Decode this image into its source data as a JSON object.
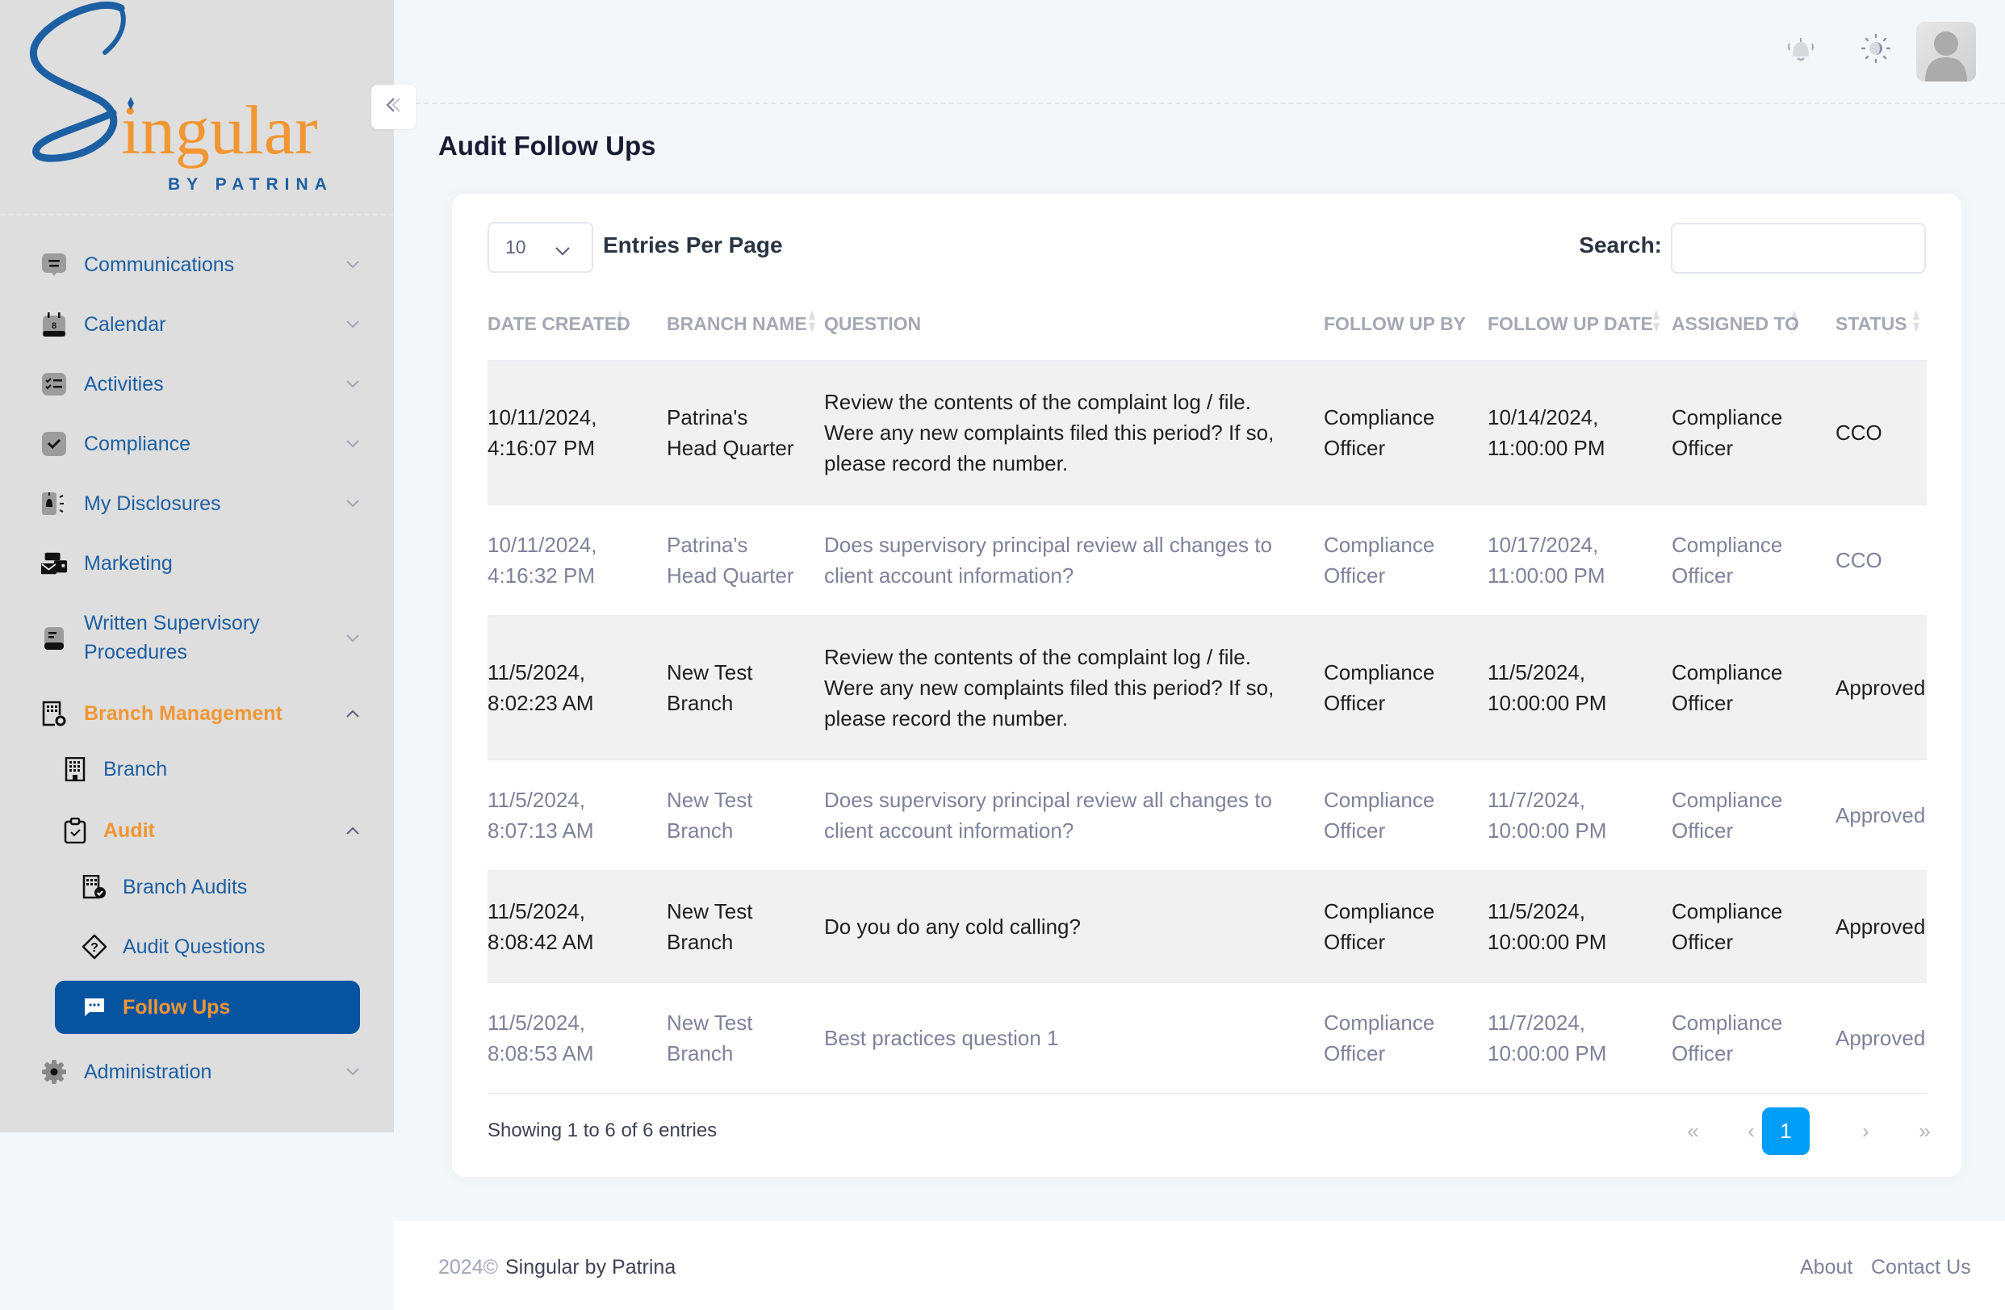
{
  "brand": {
    "logo_script_letter": "S",
    "logo_word": "ingular",
    "logo_tagline": "BY PATRINA",
    "colors": {
      "blue": "#1d5fa3",
      "orange": "#f29633",
      "active_bg": "#0653a0",
      "page_active": "#009ef7"
    }
  },
  "sidebar": {
    "collapse_icon": "double-chevron-left-icon",
    "items": [
      {
        "label": "Communications",
        "icon": "chat-lines-icon",
        "chevron": "down"
      },
      {
        "label": "Calendar",
        "icon": "calendar-icon",
        "chevron": "down"
      },
      {
        "label": "Activities",
        "icon": "checklist-icon",
        "chevron": "down"
      },
      {
        "label": "Compliance",
        "icon": "check-square-icon",
        "chevron": "down"
      },
      {
        "label": "My Disclosures",
        "icon": "disclosure-bell-icon",
        "chevron": "down"
      },
      {
        "label": "Marketing",
        "icon": "marketing-envelope-icon",
        "chevron": ""
      },
      {
        "label_line1": "Written Supervisory",
        "label_line2": "Procedures",
        "icon": "document-icon",
        "chevron": "down"
      },
      {
        "label": "Branch Management",
        "icon": "building-gear-icon",
        "chevron": "up",
        "expanded": true
      },
      {
        "label": "Branch",
        "icon": "building-icon"
      },
      {
        "label": "Audit",
        "icon": "clipboard-check-icon",
        "chevron": "up",
        "expanded": true
      },
      {
        "label": "Branch Audits",
        "icon": "building-check-icon"
      },
      {
        "label": "Audit Questions",
        "icon": "question-diamond-icon"
      },
      {
        "label": "Follow Ups",
        "icon": "chat-dots-icon",
        "active": true
      },
      {
        "label": "Administration",
        "icon": "gear-icon",
        "chevron": "down"
      }
    ]
  },
  "header": {
    "icons": [
      "bell-icon",
      "theme-toggle-icon",
      "avatar"
    ]
  },
  "page": {
    "title": "Audit Follow Ups"
  },
  "table_controls": {
    "entries_value": "10",
    "entries_label": "Entries Per Page",
    "search_label": "Search:",
    "search_value": "",
    "search_placeholder": ""
  },
  "table": {
    "columns": [
      "DATE CREATED",
      "BRANCH NAME",
      "QUESTION",
      "FOLLOW UP BY",
      "FOLLOW UP DATE",
      "ASSIGNED TO",
      "STATUS"
    ],
    "rows": [
      {
        "date_created": [
          "10/11/2024,",
          "4:16:07 PM"
        ],
        "branch_name": [
          "Patrina's",
          "Head Quarter"
        ],
        "question": [
          "Review the contents of the complaint log / file.",
          "Were any new complaints filed this period? If so,",
          "please record the number."
        ],
        "follow_up_by": [
          "Compliance",
          "Officer"
        ],
        "follow_up_date": [
          "10/14/2024,",
          "11:00:00 PM"
        ],
        "assigned_to": [
          "Compliance",
          "Officer"
        ],
        "status": "CCO"
      },
      {
        "date_created": [
          "10/11/2024,",
          "4:16:32 PM"
        ],
        "branch_name": [
          "Patrina's",
          "Head Quarter"
        ],
        "question": [
          "Does supervisory principal review all changes to",
          "client account information?"
        ],
        "follow_up_by": [
          "Compliance",
          "Officer"
        ],
        "follow_up_date": [
          "10/17/2024,",
          "11:00:00 PM"
        ],
        "assigned_to": [
          "Compliance",
          "Officer"
        ],
        "status": "CCO"
      },
      {
        "date_created": [
          "11/5/2024,",
          "8:02:23 AM"
        ],
        "branch_name": [
          "New Test",
          "Branch"
        ],
        "question": [
          "Review the contents of the complaint log / file.",
          "Were any new complaints filed this period? If so,",
          "please record the number."
        ],
        "follow_up_by": [
          "Compliance",
          "Officer"
        ],
        "follow_up_date": [
          "11/5/2024,",
          "10:00:00 PM"
        ],
        "assigned_to": [
          "Compliance",
          "Officer"
        ],
        "status": "Approved"
      },
      {
        "date_created": [
          "11/5/2024,",
          "8:07:13 AM"
        ],
        "branch_name": [
          "New Test",
          "Branch"
        ],
        "question": [
          "Does supervisory principal review all changes to",
          "client account information?"
        ],
        "follow_up_by": [
          "Compliance",
          "Officer"
        ],
        "follow_up_date": [
          "11/7/2024,",
          "10:00:00 PM"
        ],
        "assigned_to": [
          "Compliance",
          "Officer"
        ],
        "status": "Approved"
      },
      {
        "date_created": [
          "11/5/2024,",
          "8:08:42 AM"
        ],
        "branch_name": [
          "New Test",
          "Branch"
        ],
        "question": [
          "Do you do any cold calling?"
        ],
        "follow_up_by": [
          "Compliance",
          "Officer"
        ],
        "follow_up_date": [
          "11/5/2024,",
          "10:00:00 PM"
        ],
        "assigned_to": [
          "Compliance",
          "Officer"
        ],
        "status": "Approved"
      },
      {
        "date_created": [
          "11/5/2024,",
          "8:08:53 AM"
        ],
        "branch_name": [
          "New Test",
          "Branch"
        ],
        "question": [
          "Best practices question 1"
        ],
        "follow_up_by": [
          "Compliance",
          "Officer"
        ],
        "follow_up_date": [
          "11/7/2024,",
          "10:00:00 PM"
        ],
        "assigned_to": [
          "Compliance",
          "Officer"
        ],
        "status": "Approved"
      }
    ]
  },
  "pagination": {
    "summary": "Showing 1 to 6 of 6 entries",
    "first": "«",
    "prev": "‹",
    "current": "1",
    "next": "›",
    "last": "»"
  },
  "footer": {
    "year": "2024©",
    "brand": "Singular by Patrina",
    "links": [
      "About",
      "Contact Us"
    ]
  }
}
